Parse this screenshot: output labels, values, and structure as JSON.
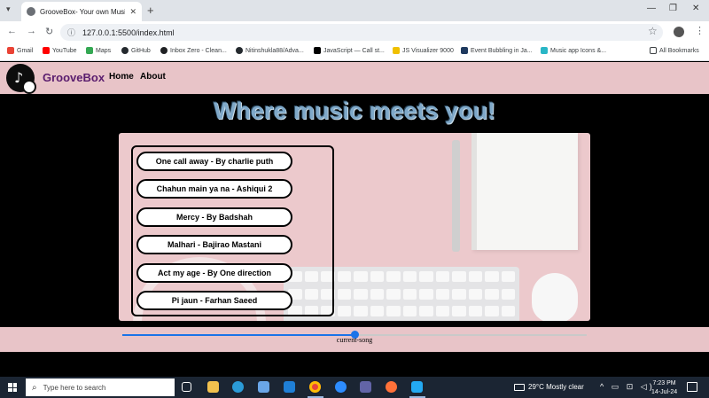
{
  "browser": {
    "tab_title": "GrooveBox- Your own Music h",
    "new_tab_glyph": "+",
    "url": "127.0.0.1:5500/index.html",
    "bookmarks": [
      {
        "label": "Gmail",
        "icon": "gmail-icon",
        "color": "#ea4335"
      },
      {
        "label": "YouTube",
        "icon": "youtube-icon",
        "color": "#ff0000"
      },
      {
        "label": "Maps",
        "icon": "maps-icon",
        "color": "#34a853"
      },
      {
        "label": "GitHub",
        "icon": "github-icon",
        "color": "#24292e"
      },
      {
        "label": "Inbox Zero - Clean...",
        "icon": "inbox-zero-icon",
        "color": "#202124"
      },
      {
        "label": "Nitinshukla88/Adva...",
        "icon": "github-icon",
        "color": "#24292e"
      },
      {
        "label": "JavaScript — Call st...",
        "icon": "javascript-icon",
        "color": "#000000"
      },
      {
        "label": "JS Visualizer 9000",
        "icon": "js-visualizer-icon",
        "color": "#f0c000"
      },
      {
        "label": "Event Bubbling in Ja...",
        "icon": "article-icon",
        "color": "#1f3a5f"
      },
      {
        "label": "Music app Icons &...",
        "icon": "icons-site-icon",
        "color": "#29b6c6"
      }
    ],
    "all_bookmarks": "All Bookmarks"
  },
  "site": {
    "brand": "GrooveBox",
    "nav": [
      {
        "label": "Home"
      },
      {
        "label": "About"
      }
    ],
    "headline": "Where music meets you!",
    "songs": [
      {
        "title": "One call away - By charlie puth"
      },
      {
        "title": "Chahun main ya na - Ashiqui 2"
      },
      {
        "title": "Mercy - By Badshah"
      },
      {
        "title": "Malhari - Bajirao Mastani"
      },
      {
        "title": "Act my age - By One direction"
      },
      {
        "title": "Pi jaun - Farhan Saeed"
      }
    ],
    "player": {
      "progress_fraction": 0.5,
      "current_song_label": "current-song"
    },
    "colors": {
      "nav_bg": "#e8c4c8",
      "brand": "#5a1d6e",
      "accent": "#1a73e8"
    }
  },
  "taskbar": {
    "search_placeholder": "Type here to search",
    "weather": "29°C  Mostly clear",
    "time": "7:23 PM",
    "date": "14-Jul-24"
  }
}
